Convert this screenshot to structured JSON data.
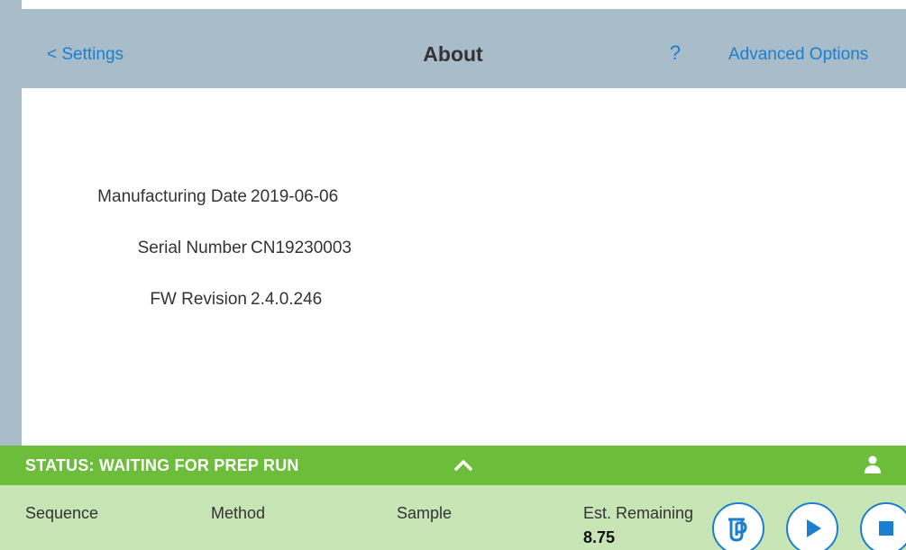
{
  "header": {
    "back_label": "< Settings",
    "title": "About",
    "help_label": "?",
    "advanced_label": "Advanced Options"
  },
  "about": {
    "rows": [
      {
        "label": "Manufacturing Date",
        "value": "2019-06-06"
      },
      {
        "label": "Serial Number",
        "value": "CN19230003"
      },
      {
        "label": "FW Revision",
        "value": "2.4.0.246"
      }
    ]
  },
  "status": {
    "text": "STATUS: WAITING FOR PREP RUN",
    "expand_icon": "chevron-up-icon",
    "user_icon": "user-icon"
  },
  "run_info": {
    "sequence_label": "Sequence",
    "method_label": "Method",
    "sample_label": "Sample",
    "remaining_label": "Est. Remaining",
    "remaining_value": "8.75"
  },
  "controls": {
    "prep_icon": "prep-tube-icon",
    "play_icon": "play-icon",
    "stop_icon": "stop-icon"
  },
  "colors": {
    "header_bg": "#a9bcc9",
    "link": "#1a7fd1",
    "status_bg": "#6cbd3a",
    "info_bg": "#c8e5b5"
  }
}
